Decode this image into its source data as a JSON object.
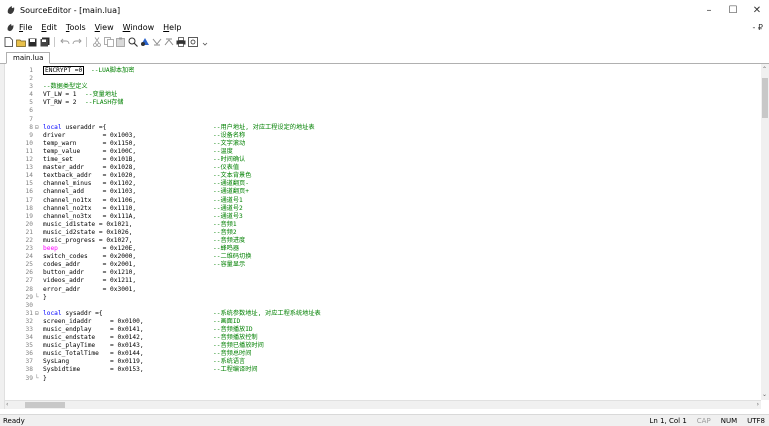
{
  "window": {
    "title": "SourceEditor - [main.lua]",
    "controls": {
      "minimize": "–",
      "maximize": "☐",
      "close": "✕"
    }
  },
  "menu": {
    "items": [
      {
        "label_accel": "F",
        "label_rest": "ile"
      },
      {
        "label_accel": "E",
        "label_rest": "dit"
      },
      {
        "label_accel": "T",
        "label_rest": "ools"
      },
      {
        "label_accel": "V",
        "label_rest": "iew"
      },
      {
        "label_accel": "W",
        "label_rest": "indow"
      },
      {
        "label_accel": "H",
        "label_rest": "elp"
      }
    ],
    "mdi_controls": "- ₽"
  },
  "toolbar": {
    "icons": [
      "new-file-icon",
      "open-folder-icon",
      "save-icon",
      "save-all-icon",
      "undo-icon",
      "redo-icon",
      "cut-icon",
      "copy-icon",
      "paste-icon",
      "find-icon",
      "replace-icon",
      "find-next-icon",
      "find-prev-icon",
      "print-icon",
      "settings-icon"
    ]
  },
  "tabs": [
    {
      "label": "main.lua",
      "active": true
    }
  ],
  "editor": {
    "lines": [
      {
        "n": "1",
        "code": "ENCRYPT =0",
        "comment": "--LUA脚本加密",
        "ccol": 86,
        "boxed": true
      },
      {
        "n": "2",
        "code": ""
      },
      {
        "n": "3",
        "code": "",
        "comment": "--数据类型定义",
        "ccol": 38
      },
      {
        "n": "4",
        "code": "VT_LW = 1",
        "comment": "--变量地址",
        "ccol": 80
      },
      {
        "n": "5",
        "code": "VT_RW = 2",
        "comment": "--FLASH存储",
        "ccol": 80
      },
      {
        "n": "6",
        "code": ""
      },
      {
        "n": "7",
        "code": ""
      },
      {
        "n": "8",
        "kw": "local",
        "code": " useraddr ={",
        "comment": "--用户地址, 对应工程设定的地址表",
        "fold": "⊟",
        "ccol": 208
      },
      {
        "n": "9",
        "code": "driver          = 0x1003,",
        "comment": "--设备名称",
        "ccol": 208
      },
      {
        "n": "10",
        "code": "temp_warn       = 0x1150,",
        "comment": "--文字滚动",
        "ccol": 208
      },
      {
        "n": "11",
        "code": "temp_value      = 0x100C,",
        "comment": "--温度",
        "ccol": 208
      },
      {
        "n": "12",
        "code": "time_set        = 0x101B,",
        "comment": "--时间确认",
        "ccol": 208
      },
      {
        "n": "13",
        "code": "master_addr     = 0x1028,",
        "comment": "--仪表值",
        "ccol": 208
      },
      {
        "n": "14",
        "code": "textback_addr   = 0x1020,",
        "comment": "--文本背景色",
        "ccol": 208
      },
      {
        "n": "15",
        "code": "channel_minus   = 0x1102,",
        "comment": "--通道翻页-",
        "ccol": 208
      },
      {
        "n": "16",
        "code": "channel_add     = 0x1103,",
        "comment": "--通道翻页+",
        "ccol": 208
      },
      {
        "n": "17",
        "code": "channel_no1tx   = 0x1106,",
        "comment": "--通道号1",
        "ccol": 208
      },
      {
        "n": "18",
        "code": "channel_no2tx   = 0x1110,",
        "comment": "--通道号2",
        "ccol": 208
      },
      {
        "n": "19",
        "code": "channel_no3tx   = 0x111A,",
        "comment": "--通道号3",
        "ccol": 208
      },
      {
        "n": "20",
        "code": "music_id1state = 0x1021,",
        "comment": "--音频1",
        "ccol": 208
      },
      {
        "n": "21",
        "code": "music_id2state = 0x1026,",
        "comment": "--音频2",
        "ccol": 208
      },
      {
        "n": "22",
        "code": "music_progress = 0x1027,",
        "comment": "--音频进度",
        "ccol": 208
      },
      {
        "n": "23",
        "builtin": "beep",
        "code": "            = 0x120E,",
        "comment": "--蜂鸣器",
        "ccol": 208
      },
      {
        "n": "24",
        "code": "switch_codes    = 0x2000,",
        "comment": "--二维码切换",
        "ccol": 208
      },
      {
        "n": "25",
        "code": "codes_addr      = 0x2001,",
        "comment": "--容量显示",
        "ccol": 208
      },
      {
        "n": "26",
        "code": "button_addr     = 0x1210,"
      },
      {
        "n": "27",
        "code": "videos_addr     = 0x1211,"
      },
      {
        "n": "28",
        "code": "error_addr      = 0x3001,"
      },
      {
        "n": "29",
        "code": "}",
        "fold": "└"
      },
      {
        "n": "30",
        "code": ""
      },
      {
        "n": "31",
        "kw": "local",
        "code": " sysaddr ={",
        "comment": "--系统参数地址, 对应工程系统地址表",
        "fold": "⊟",
        "ccol": 208
      },
      {
        "n": "32",
        "code": "screen_idaddr     = 0x0100,",
        "comment": "--画面ID",
        "ccol": 208
      },
      {
        "n": "33",
        "code": "music_endplay     = 0x0141,",
        "comment": "--音频播放ID",
        "ccol": 208
      },
      {
        "n": "34",
        "code": "music_endstate    = 0x0142,",
        "comment": "--音频播放控制",
        "ccol": 208
      },
      {
        "n": "35",
        "code": "music_playTime    = 0x0143,",
        "comment": "--音频已播放时间",
        "ccol": 208
      },
      {
        "n": "36",
        "code": "music_TotalTime   = 0x0144,",
        "comment": "--音频总时间",
        "ccol": 208
      },
      {
        "n": "37",
        "code": "SysLang           = 0x0119,",
        "comment": "--系统语言",
        "ccol": 208
      },
      {
        "n": "38",
        "code": "Sysbidtime        = 0x0153,",
        "comment": "--工程编译时间",
        "ccol": 208
      },
      {
        "n": "39",
        "code": "}",
        "fold": "└"
      }
    ]
  },
  "status": {
    "left": "Ready",
    "position": "Ln 1, Col 1",
    "cap": "CAP",
    "num": "NUM",
    "encoding": "UTF8"
  },
  "colors": {
    "comment": "#008000",
    "keyword": "#0000ff",
    "builtin": "#ff00ff",
    "line_number": "#808080"
  }
}
